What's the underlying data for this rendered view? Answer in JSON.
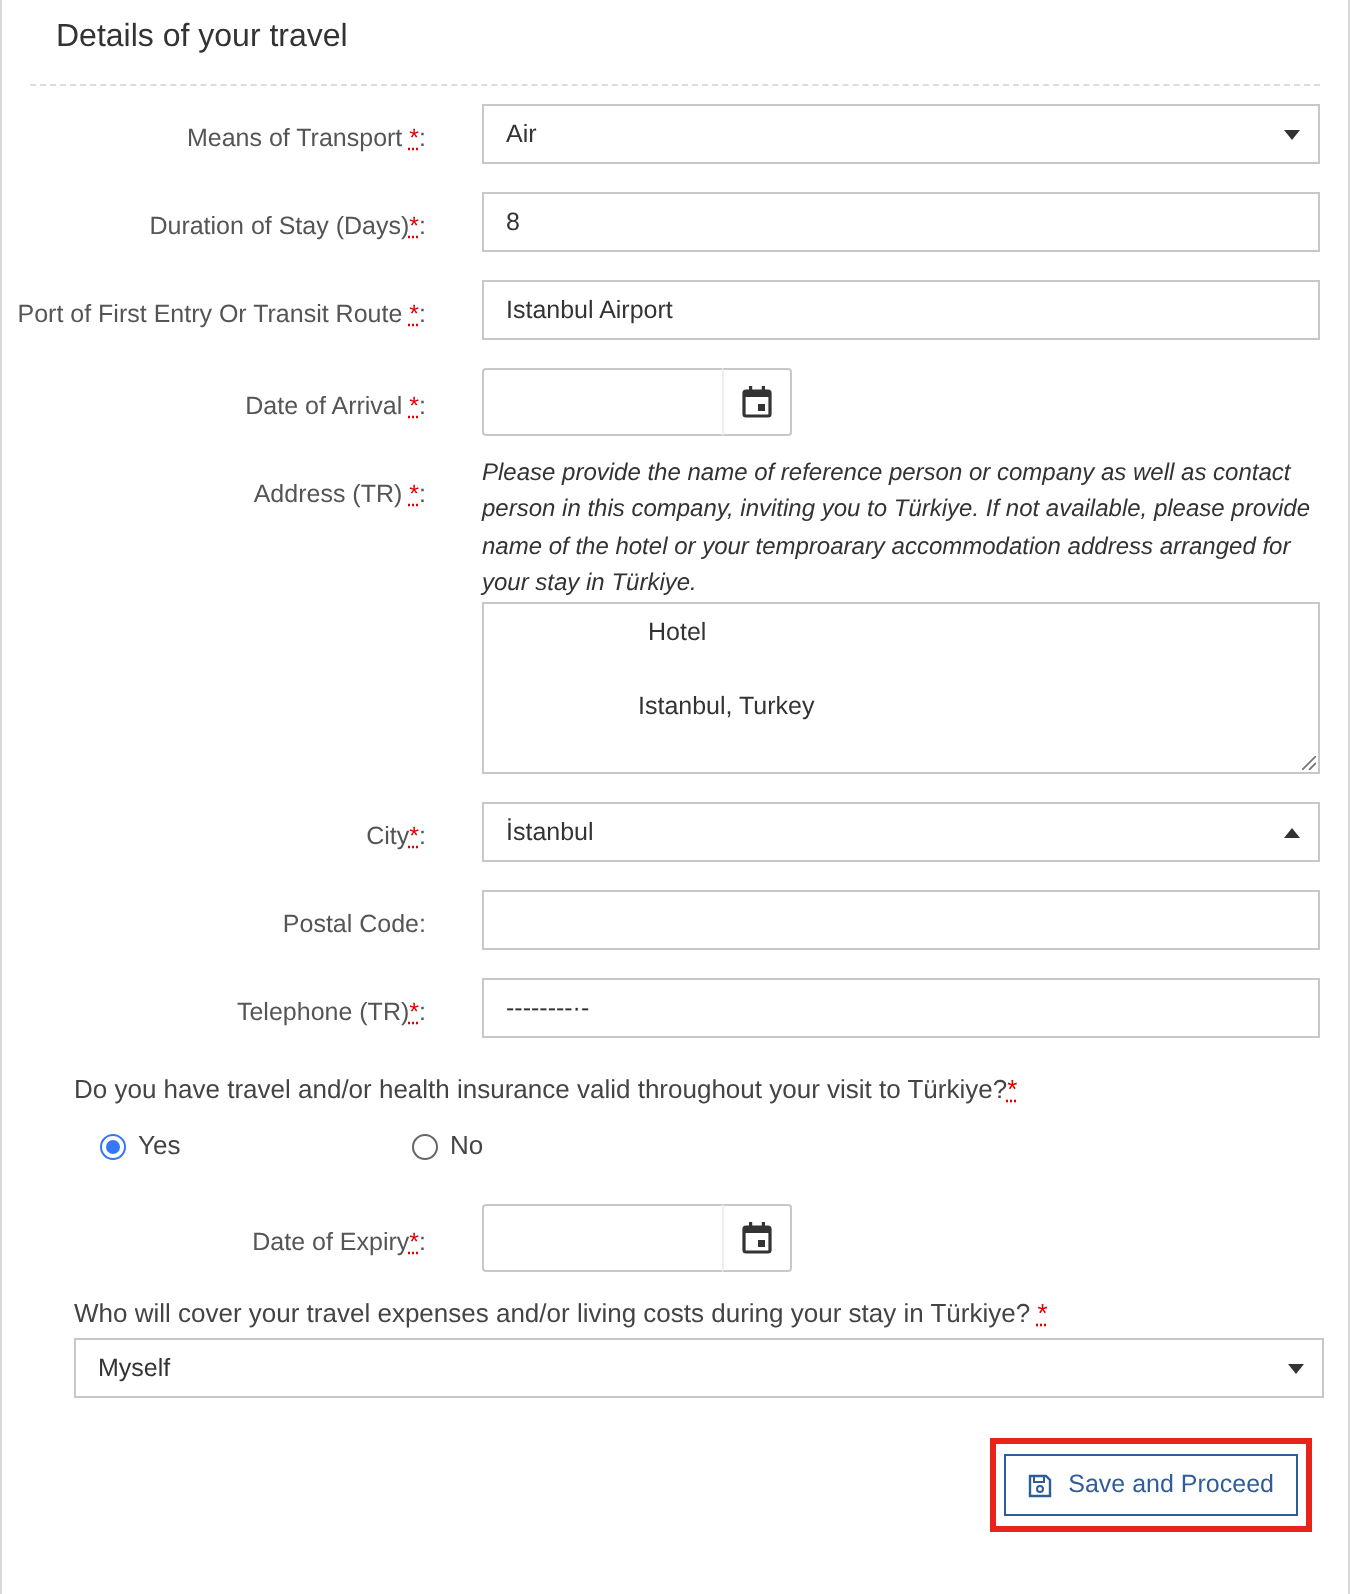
{
  "panel": {
    "title": "Details of your travel"
  },
  "fields": [
    {
      "kind": "select",
      "label": "Means of Transport ",
      "mark": "*",
      "label_end": ":",
      "value": "Air",
      "expanded": false
    },
    {
      "kind": "text",
      "label": "Duration of Stay (Days)",
      "mark": "*",
      "label_end": ":",
      "value": "8"
    },
    {
      "kind": "text",
      "label": "Port of First Entry Or Transit Route ",
      "mark": "*",
      "label_end": ":",
      "value": "Istanbul Airport"
    },
    {
      "kind": "date",
      "label": "Date of Arrival ",
      "mark": "*",
      "label_end": ":"
    },
    {
      "kind": "textarea",
      "label": "Address (TR) ",
      "mark": "*",
      "label_end": ":",
      "help": "Please provide the name of reference person or company as well as contact person in this company, inviting you to Türkiye. If not available, please provide name of the hotel or your temproarary accommodation address arranged for your stay in Türkiye.",
      "value_lines": [
        "Hotel",
        "Istanbul, Turkey"
      ]
    },
    {
      "kind": "select",
      "label": "City",
      "mark": "*",
      "label_end": ":",
      "value": "İstanbul",
      "expanded": true
    },
    {
      "kind": "text",
      "label": "Postal Code",
      "label_end": ":"
    },
    {
      "kind": "text",
      "label": "Telephone (TR)",
      "mark": "*",
      "label_end": ":",
      "value": "--------·-"
    }
  ],
  "insurance": {
    "question": "Do you have travel and/or health insurance valid throughout your visit to Türkiye?",
    "mark": "*",
    "options": [
      {
        "label": "Yes",
        "selected": true
      },
      {
        "label": "No",
        "selected": false
      }
    ],
    "expiry": {
      "kind": "date",
      "label": "Date of Expiry",
      "mark": "*",
      "label_end": ":"
    }
  },
  "expenses": {
    "question": "Who will cover your travel expenses and/or living costs during your stay in Türkiye? ",
    "mark": "*",
    "value": "Myself",
    "expanded": false
  },
  "actions": {
    "save": {
      "label": "Save and Proceed",
      "highlighted": true
    }
  }
}
